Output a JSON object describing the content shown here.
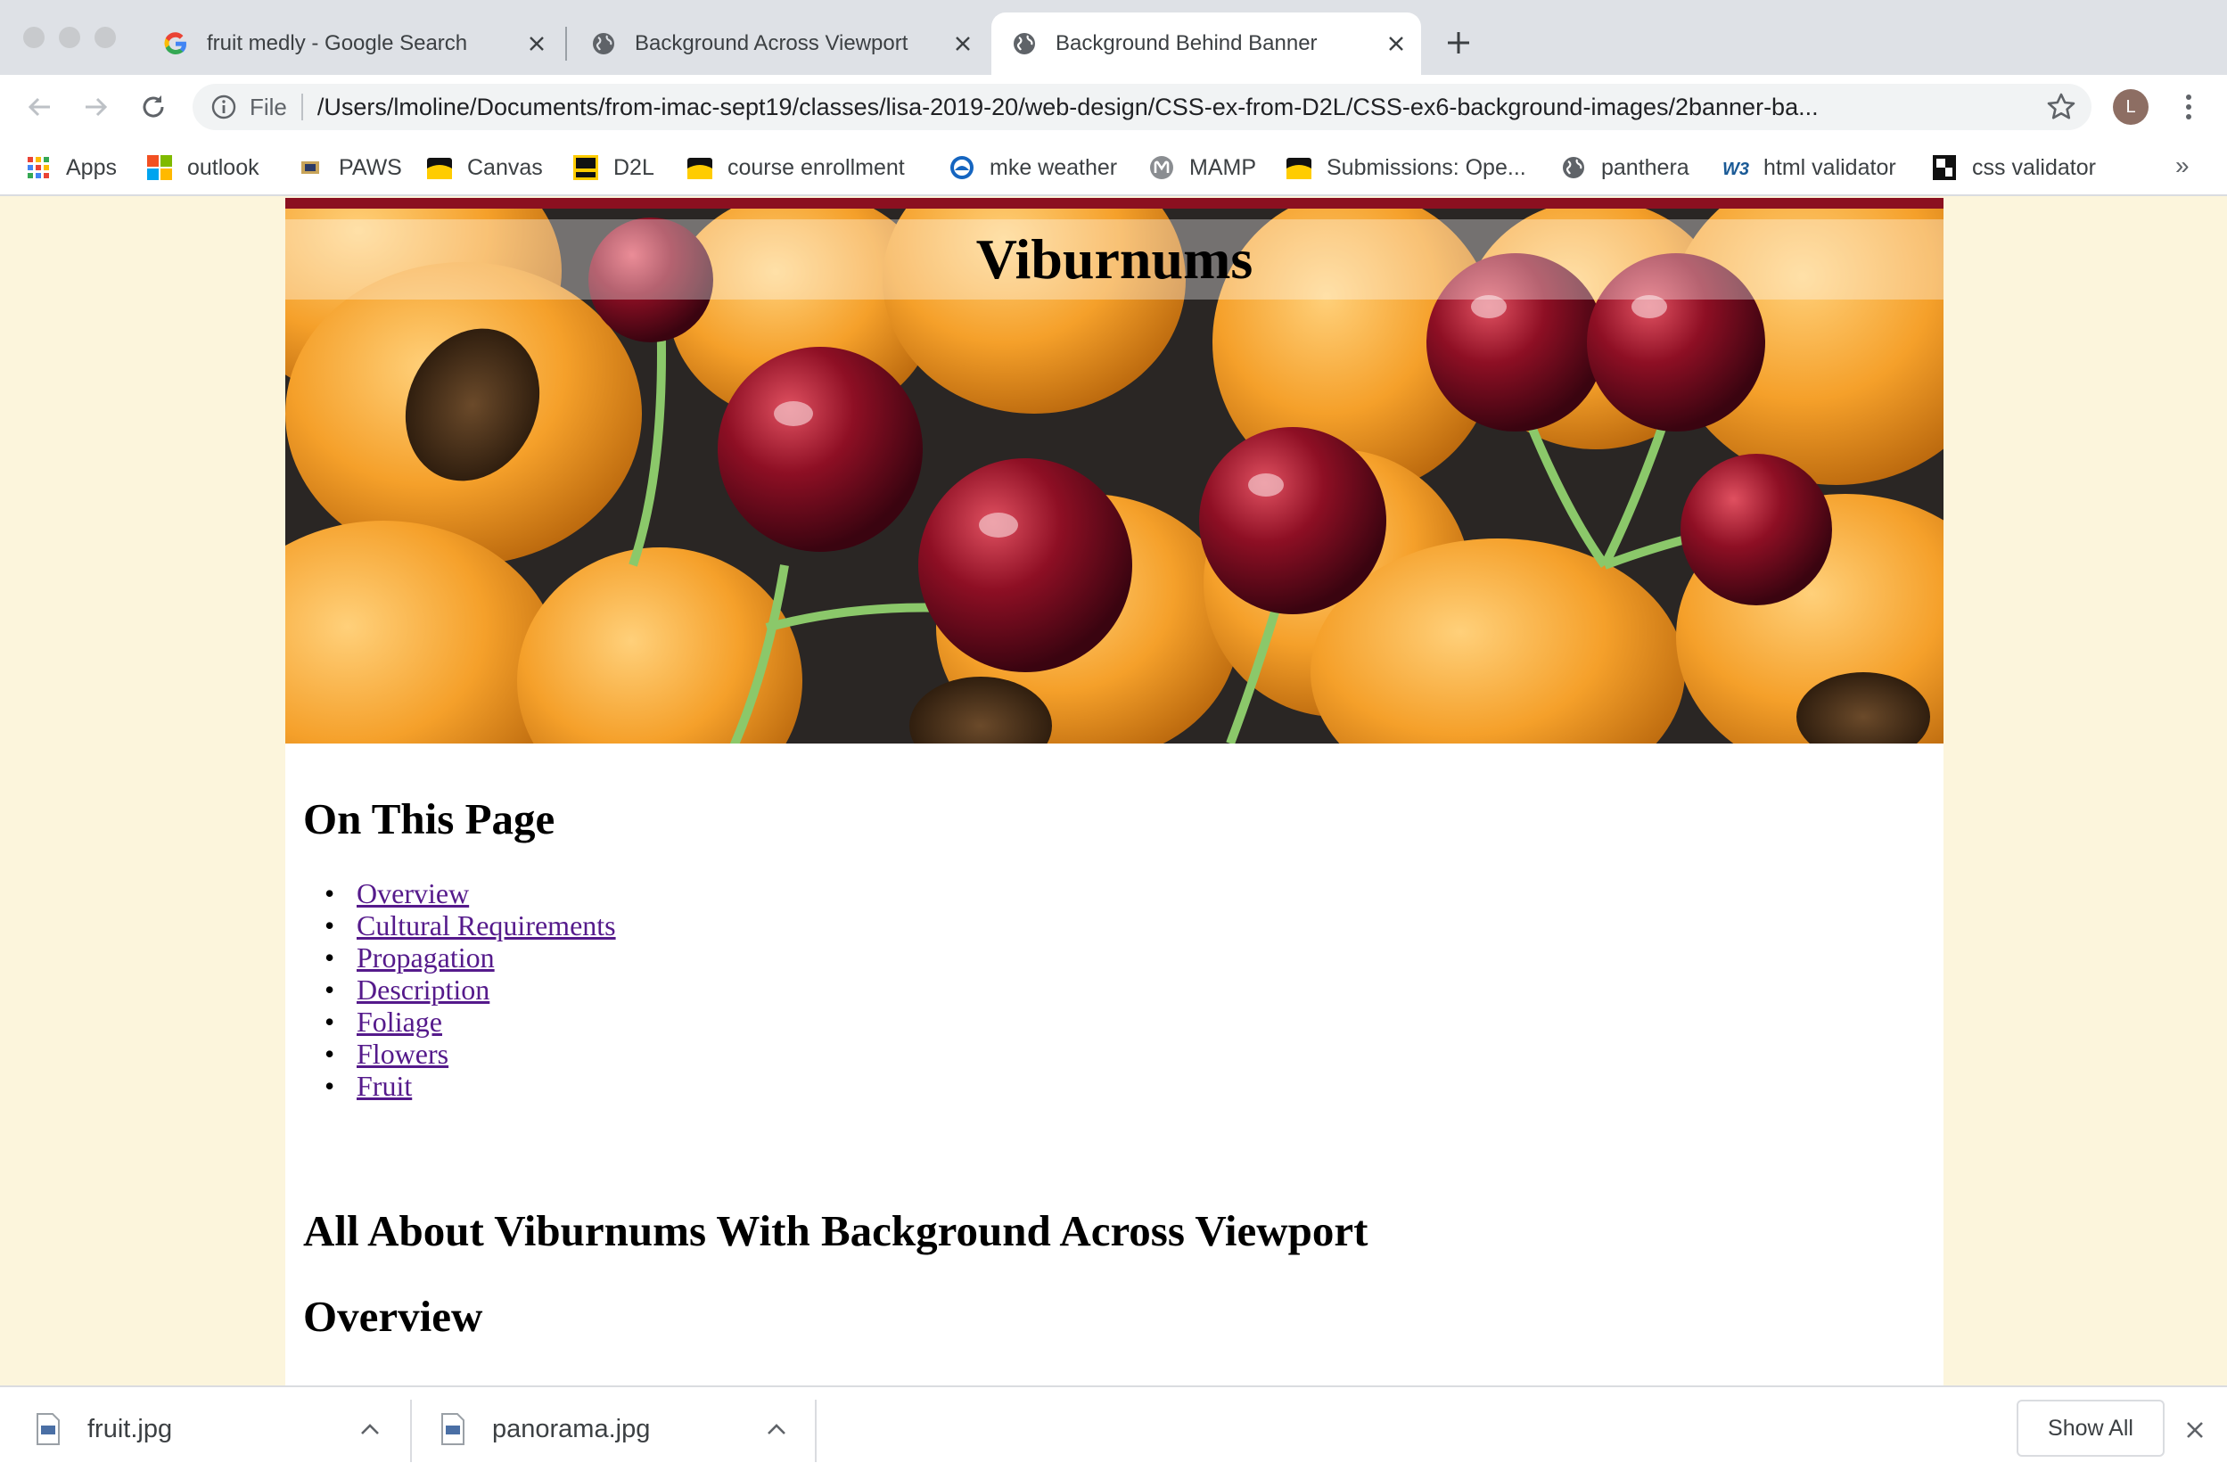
{
  "tabs": [
    {
      "title": "fruit medly - Google Search",
      "icon": "google-icon",
      "active": false
    },
    {
      "title": "Background Across Viewport",
      "icon": "globe-icon",
      "active": false
    },
    {
      "title": "Background Behind Banner",
      "icon": "globe-icon",
      "active": true
    }
  ],
  "toolbar": {
    "scheme": "File",
    "url": "/Users/lmoline/Documents/from-imac-sept19/classes/lisa-2019-20/web-design/CSS-ex-from-D2L/CSS-ex6-background-images/2banner-ba...",
    "profile_initial": "L"
  },
  "bookmarks": [
    {
      "label": "Apps",
      "icon": "apps-grid-icon"
    },
    {
      "label": "outlook",
      "icon": "microsoft-icon"
    },
    {
      "label": "PAWS",
      "icon": "paws-icon"
    },
    {
      "label": "Canvas",
      "icon": "folder-icon"
    },
    {
      "label": "D2L",
      "icon": "d2l-icon"
    },
    {
      "label": "course enrollment",
      "icon": "folder-icon"
    },
    {
      "label": "mke weather",
      "icon": "noaa-icon"
    },
    {
      "label": "MAMP",
      "icon": "mamp-icon"
    },
    {
      "label": "Submissions: Ope...",
      "icon": "folder-icon"
    },
    {
      "label": "panthera",
      "icon": "globe-icon"
    },
    {
      "label": "html validator",
      "icon": "w3c-icon"
    },
    {
      "label": "css validator",
      "icon": "css-validator-icon"
    }
  ],
  "bookmarks_overflow": "»",
  "page": {
    "banner_title": "Viburnums",
    "on_this_page": "On This Page",
    "toc": [
      "Overview",
      "Cultural Requirements",
      "Propagation",
      "Description",
      "Foliage",
      "Flowers",
      "Fruit"
    ],
    "heading_all": "All About Viburnums With Background Across Viewport",
    "heading_overview": "Overview"
  },
  "downloads": [
    {
      "name": "fruit.jpg"
    },
    {
      "name": "panorama.jpg"
    }
  ],
  "show_all": "Show All",
  "colors": {
    "page_background": "#fcf5dc",
    "content_background": "#ffffff",
    "banner_border": "#8b1020",
    "link_visited": "#551a8b"
  }
}
